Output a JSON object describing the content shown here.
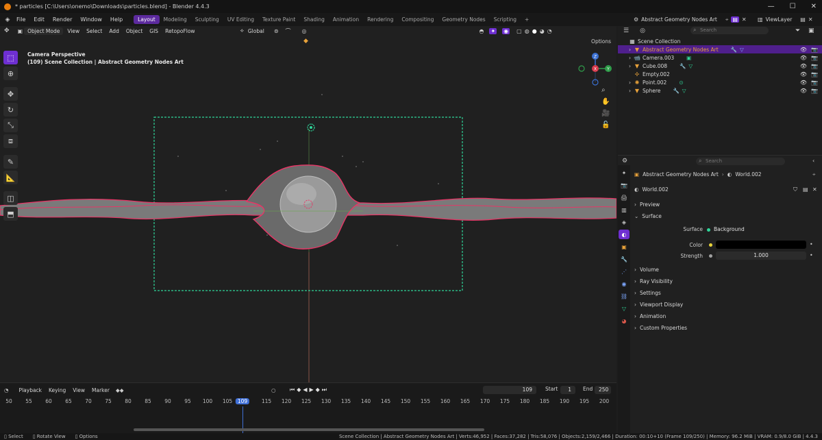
{
  "titlebar": {
    "title": "* particles [C:\\Users\\onemo\\Downloads\\particles.blend] - Blender 4.4.3",
    "minimize": "—",
    "maximize": "☐",
    "close": "✕"
  },
  "menu": [
    "File",
    "Edit",
    "Render",
    "Window",
    "Help"
  ],
  "workspaces": [
    {
      "label": "Layout",
      "active": true
    },
    {
      "label": "Modeling"
    },
    {
      "label": "Sculpting"
    },
    {
      "label": "UV Editing"
    },
    {
      "label": "Texture Paint"
    },
    {
      "label": "Shading"
    },
    {
      "label": "Animation"
    },
    {
      "label": "Rendering"
    },
    {
      "label": "Compositing"
    },
    {
      "label": "Geometry Nodes"
    },
    {
      "label": "Scripting"
    },
    {
      "label": "+"
    }
  ],
  "scene_name": "Abstract Geometry Nodes Art",
  "view_layer": "ViewLayer",
  "viewport": {
    "mode": "Object Mode",
    "menus": [
      "View",
      "Select",
      "Add",
      "Object",
      "GIS",
      "RetopoFlow"
    ],
    "transform_orientation": "Global",
    "camera_title": "Camera Perspective",
    "camera_sub": "(109) Scene Collection | Abstract Geometry Nodes Art",
    "options": "Options",
    "gizmo": {
      "z": "Z",
      "y": "Y",
      "x": "X"
    }
  },
  "timeline": {
    "menus": [
      "Playback",
      "Keying",
      "View",
      "Marker"
    ],
    "current_frame": "109",
    "start_label": "Start",
    "start": "1",
    "end_label": "End",
    "end": "250",
    "ticks": [
      "50",
      "55",
      "60",
      "65",
      "70",
      "75",
      "80",
      "85",
      "90",
      "95",
      "100",
      "105",
      "109",
      "115",
      "120",
      "125",
      "130",
      "135",
      "140",
      "145",
      "150",
      "155",
      "160",
      "165",
      "170",
      "175",
      "180",
      "185",
      "190",
      "195",
      "200"
    ]
  },
  "statusbar": {
    "left": [
      "Select",
      "Rotate View",
      "Options"
    ],
    "right": "Scene Collection | Abstract Geometry Nodes Art | Verts:46,952 | Faces:37,282 | Tris:58,076 | Objects:2,159/2,466 | Duration: 00:10+10 (Frame 109/250) | Memory: 96.2 MiB | VRAM: 0.9/8.0 GiB | 4.4.3"
  },
  "outliner": {
    "search_placeholder": "Search",
    "root": "Scene Collection",
    "items": [
      {
        "label": "Abstract Geometry Nodes Art",
        "selected": true,
        "icon": "▽"
      },
      {
        "label": "Camera.003",
        "icon": "▣"
      },
      {
        "label": "Cube.008",
        "icon": "▽"
      },
      {
        "label": "Empty.002",
        "icon": "✢"
      },
      {
        "label": "Point.002",
        "icon": "✺"
      },
      {
        "label": "Sphere",
        "icon": "▽"
      }
    ]
  },
  "properties": {
    "search_placeholder": "Search",
    "breadcrumb_object": "Abstract Geometry Nodes Art",
    "breadcrumb_world": "World.002",
    "world_name": "World.002",
    "panels": {
      "preview": "Preview",
      "surface": "Surface",
      "volume": "Volume",
      "ray_visibility": "Ray Visibility",
      "settings": "Settings",
      "viewport_display": "Viewport Display",
      "animation": "Animation",
      "custom_properties": "Custom Properties"
    },
    "surface_label": "Surface",
    "surface_value": "Background",
    "color_label": "Color",
    "strength_label": "Strength",
    "strength_value": "1.000"
  },
  "colors": {
    "accent": "#6e2fd1",
    "outline_pink": "#e83566",
    "camera_green": "#2fd69a",
    "playhead": "#3f6fd6"
  }
}
